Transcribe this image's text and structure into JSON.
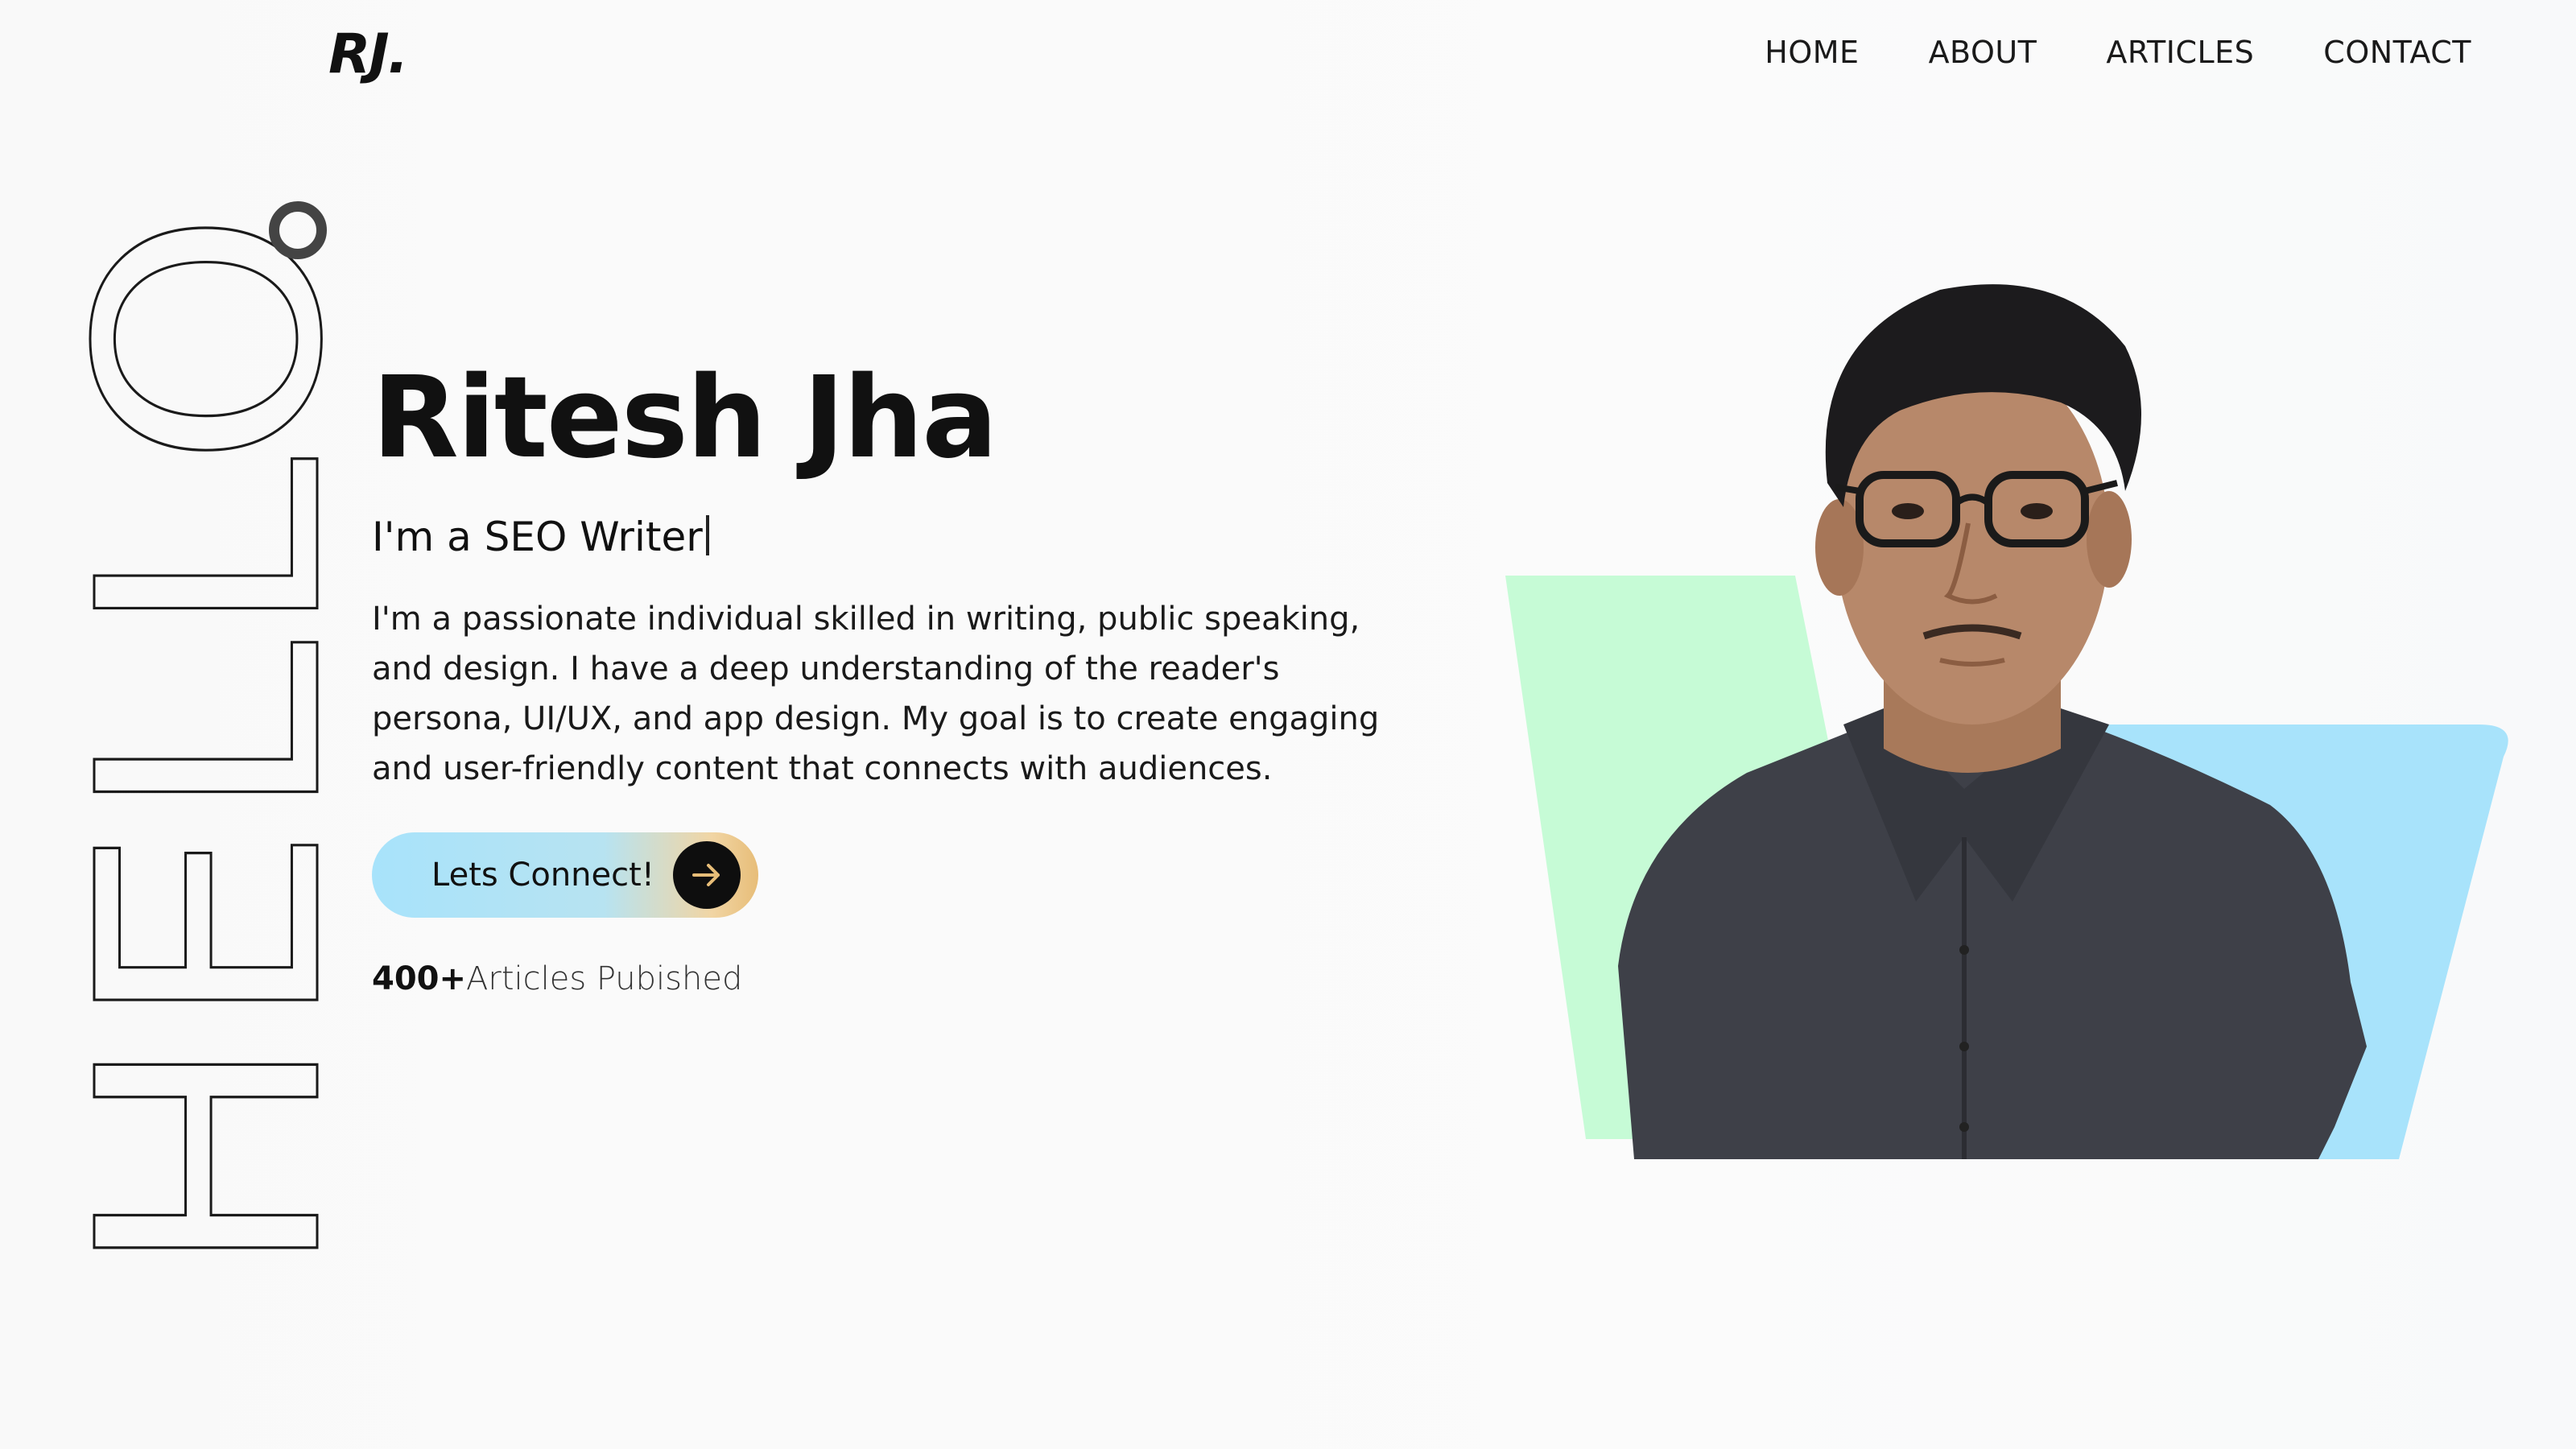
{
  "header": {
    "logo": "RJ.",
    "nav": [
      {
        "label": "HOME"
      },
      {
        "label": "ABOUT"
      },
      {
        "label": "ARTICLES"
      },
      {
        "label": "CONTACT"
      }
    ]
  },
  "hero": {
    "decor_word": "HELLO",
    "name": "Ritesh Jha",
    "role": "I'm a SEO Writer",
    "description": "I'm a passionate individual skilled in writing, public speaking, and design. I have a deep understanding of the reader's persona, UI/UX, and app design. My goal is to create engaging and user-friendly content that connects with audiences.",
    "cta_label": "Lets Connect!",
    "stat_number": "400+",
    "stat_label": "Articles Pubished"
  },
  "colors": {
    "accent_blue": "#a8e3fb",
    "accent_green": "#c6fbd6",
    "accent_gold": "#e7bd78",
    "text": "#111111"
  },
  "icons": {
    "cta": "arrow-right-icon"
  }
}
